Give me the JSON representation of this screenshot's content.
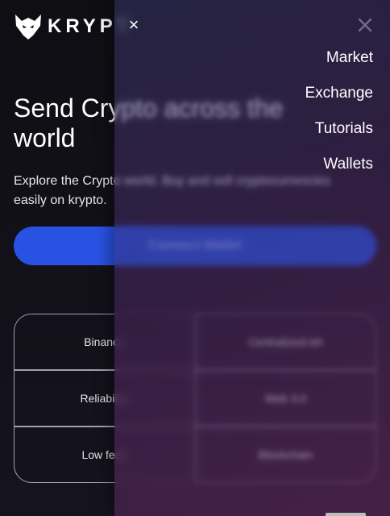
{
  "header": {
    "logo_text": "KRYPT",
    "close_symbol": "×"
  },
  "hero": {
    "title": "Send Crypto across the world",
    "subtitle": "Explore the Crypto world. Buy and sell cryptocurrencies easily on krypto.",
    "connect_label": "Connect Wallet"
  },
  "features": [
    {
      "label": "Binance"
    },
    {
      "label": "Centralized-ish"
    },
    {
      "label": "Reliability"
    },
    {
      "label": "Web 3.0"
    },
    {
      "label": "Low fees"
    },
    {
      "label": "Blockchain"
    }
  ],
  "drawer": {
    "menu": [
      {
        "label": "Market"
      },
      {
        "label": "Exchange"
      },
      {
        "label": "Tutorials"
      },
      {
        "label": "Wallets"
      }
    ]
  },
  "colors": {
    "background": "#0f0e13",
    "accent": "#2952e3",
    "drawer_tint": "#3c224e"
  },
  "icons": {
    "logo": "fox-logo-icon",
    "close": "close-icon"
  }
}
